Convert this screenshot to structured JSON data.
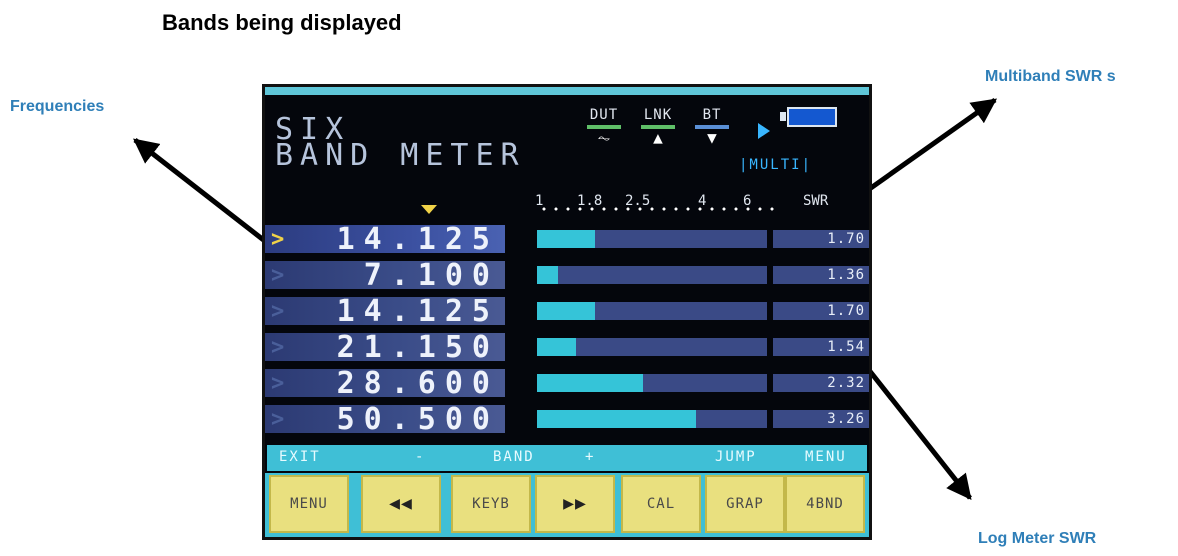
{
  "heading": "Bands being displayed",
  "callouts": {
    "frequencies": "Frequencies",
    "multiband": "Multiband SWR s",
    "logmeter": "Log Meter SWR"
  },
  "device": {
    "title_line1": "SIX",
    "title_line2": "BAND METER",
    "indicators": [
      {
        "label": "DUT",
        "bar_color": "#5fbf68",
        "symbol": "⏦"
      },
      {
        "label": "LNK",
        "bar_color": "#5fbf68",
        "symbol": "▲"
      },
      {
        "label": "BT",
        "bar_color": "#5a8fd6",
        "symbol": "▼"
      }
    ],
    "mode": "|MULTI|",
    "scale": {
      "ticks": [
        "1",
        "1.8",
        "2.5",
        "4",
        "6"
      ],
      "unit": "SWR"
    },
    "bands": [
      {
        "freq": "14.125",
        "swr": "1.70",
        "meter": 0.25,
        "selected": true
      },
      {
        "freq": "7.100",
        "swr": "1.36",
        "meter": 0.09,
        "selected": false
      },
      {
        "freq": "14.125",
        "swr": "1.70",
        "meter": 0.25,
        "selected": false
      },
      {
        "freq": "21.150",
        "swr": "1.54",
        "meter": 0.17,
        "selected": false
      },
      {
        "freq": "28.600",
        "swr": "2.32",
        "meter": 0.46,
        "selected": false
      },
      {
        "freq": "50.500",
        "swr": "3.26",
        "meter": 0.69,
        "selected": false
      }
    ],
    "legend": {
      "exit": "EXIT",
      "minus": "-",
      "band": "BAND",
      "plus": "+",
      "jump": "JUMP",
      "menu": "MENU"
    },
    "buttons": {
      "menu": "MENU",
      "prev": "◀◀",
      "keyb": "KEYB",
      "next": "▶▶",
      "cal": "CAL",
      "grap": "GRAP",
      "fourbnd": "4BND"
    }
  }
}
